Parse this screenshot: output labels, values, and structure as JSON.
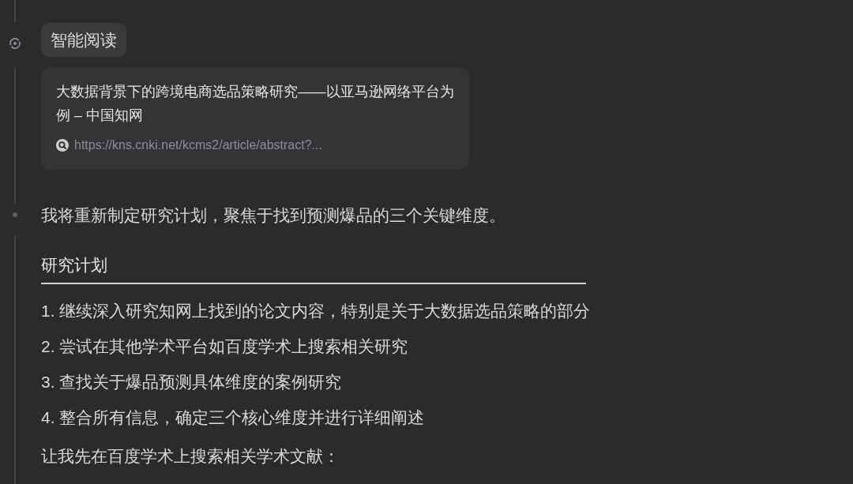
{
  "reading_step": {
    "label": "智能阅读",
    "source_card": {
      "title": "大数据背景下的跨境电商选品策略研究——以亚马逊网络平台为例 – 中国知网",
      "url": "https://kns.cnki.net/kcms2/article/abstract?..."
    }
  },
  "message": {
    "intro": "我将重新制定研究计划，聚焦于找到预测爆品的三个关键维度。",
    "plan_heading": "研究计划",
    "plan_items": [
      "1. 继续深入研究知网上找到的论文内容，特别是关于大数据选品策略的部分",
      "2. 尝试在其他学术平台如百度学术上搜索相关研究",
      "3. 查找关于爆品预测具体维度的案例研究",
      "4. 整合所有信息，确定三个核心维度并进行详细阐述"
    ],
    "closing": "让我先在百度学术上搜索相关学术文献："
  }
}
